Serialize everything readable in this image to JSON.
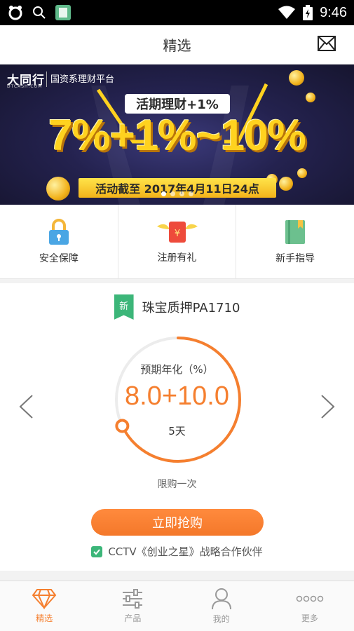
{
  "status_bar": {
    "time": "9:46"
  },
  "header": {
    "title": "精选"
  },
  "banner": {
    "logo": "大同行",
    "logo_sub": "DTCASH.COM",
    "partner": "国资系理财平台",
    "pill": "活期理财+1%",
    "headline": "7%+1%~10%",
    "ribbon": "活动截至 2017年4月11日24点"
  },
  "quick_menu": [
    {
      "label": "安全保障",
      "icon": "lock-icon"
    },
    {
      "label": "注册有礼",
      "icon": "red-envelope-icon"
    },
    {
      "label": "新手指导",
      "icon": "book-icon"
    }
  ],
  "product": {
    "tag": "新",
    "name": "珠宝质押PA1710",
    "rate_caption": "预期年化（%）",
    "rate_value": "8.0+10.0",
    "term": "5天",
    "progress_percent": 68,
    "limit": "限购一次",
    "buy_label": "立即抢购",
    "partner_text": "CCTV《创业之星》战略合作伙伴"
  },
  "tabs": [
    {
      "label": "精选",
      "icon": "diamond-icon",
      "active": true
    },
    {
      "label": "产品",
      "icon": "sliders-icon",
      "active": false
    },
    {
      "label": "我的",
      "icon": "user-icon",
      "active": false
    },
    {
      "label": "更多",
      "icon": "more-dots-icon",
      "active": false
    }
  ],
  "colors": {
    "accent": "#f57f2f",
    "green": "#3cb679"
  }
}
